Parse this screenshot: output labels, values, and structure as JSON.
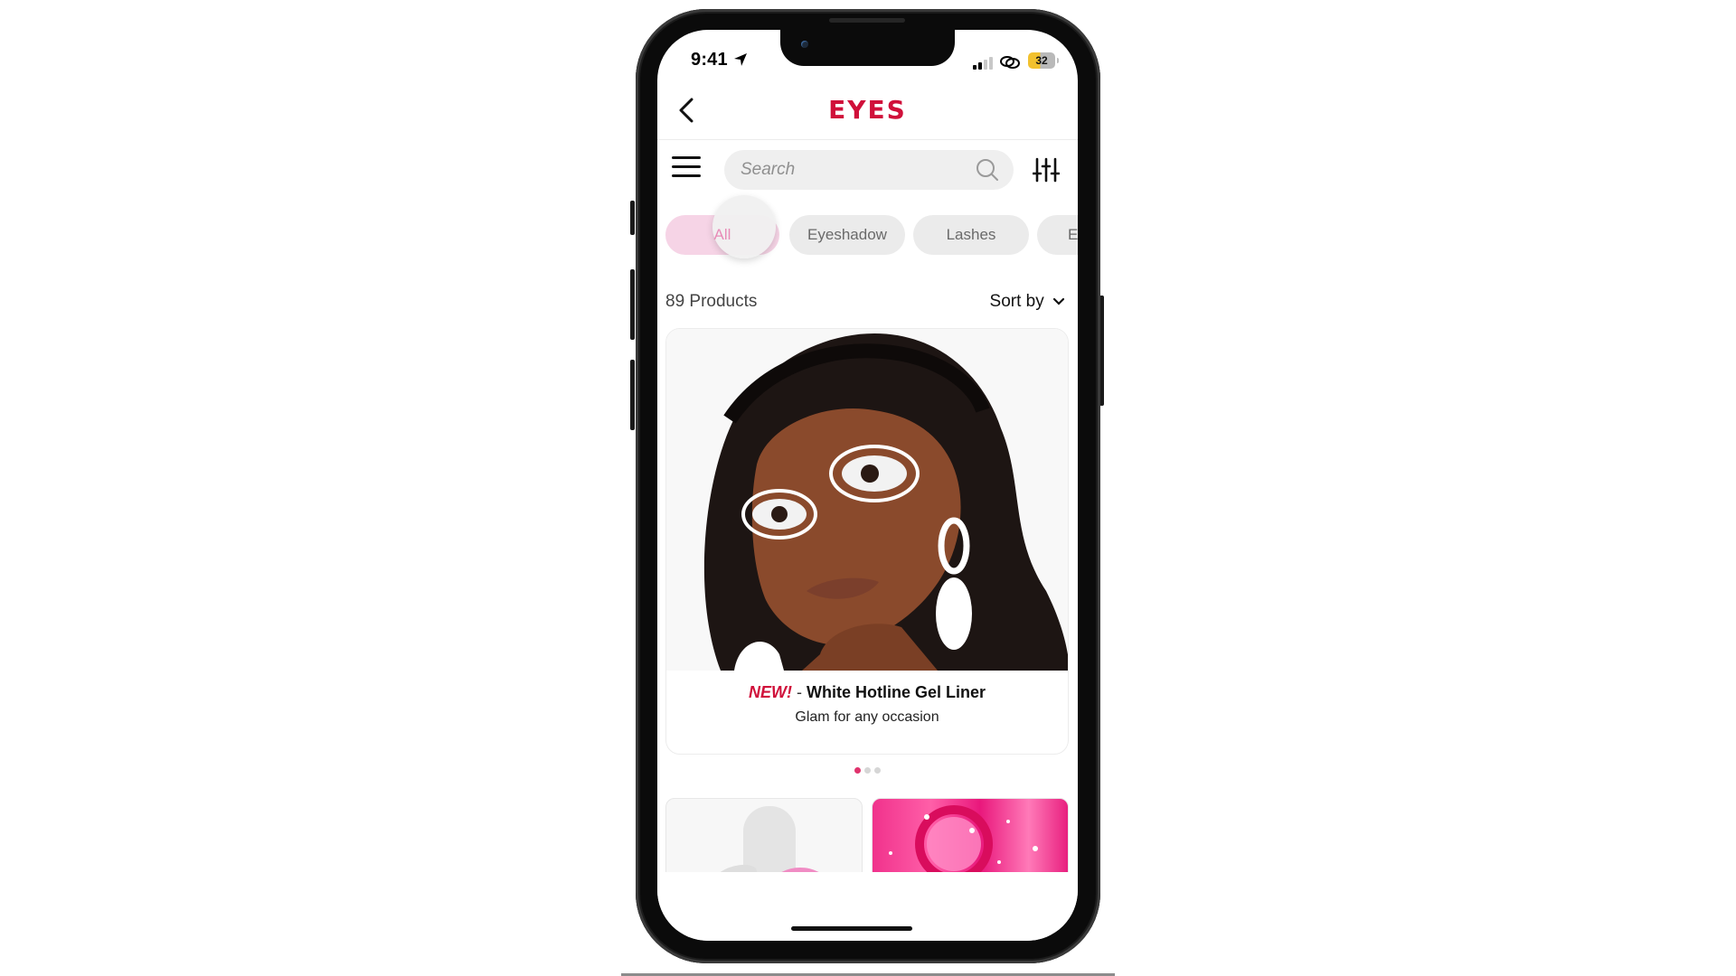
{
  "status_bar": {
    "time": "9:41",
    "battery": "32",
    "icons": [
      "location-arrow-icon",
      "signal-icon",
      "link-icon",
      "battery-icon"
    ]
  },
  "nav": {
    "back_icon": "chevron-left-icon",
    "title": "EYES",
    "title_color": "#d0103a"
  },
  "toolbar": {
    "menu_icon": "hamburger-menu-icon",
    "search": {
      "placeholder": "Search",
      "value": ""
    },
    "search_icon": "search-icon",
    "filter_icon": "sliders-icon"
  },
  "categories": [
    {
      "label": "All",
      "active": true
    },
    {
      "label": "Eyeshadow",
      "active": false
    },
    {
      "label": "Lashes",
      "active": false
    },
    {
      "label": "E",
      "active": false
    }
  ],
  "listing": {
    "count": "89 Products",
    "sort_label": "Sort by"
  },
  "hero": {
    "badge": "NEW!",
    "separator": "-",
    "title": "White Hotline Gel Liner",
    "subtitle": "Glam for any occasion",
    "image": "model-with-white-graphic-eyeliner-and-white-earrings"
  },
  "carousel": {
    "pages": 3,
    "active_index": 0,
    "active_color": "#e0336d"
  },
  "grid_tiles": [
    {
      "image": "white-product-with-pink-accent"
    },
    {
      "image": "pink-glitter-product"
    }
  ]
}
